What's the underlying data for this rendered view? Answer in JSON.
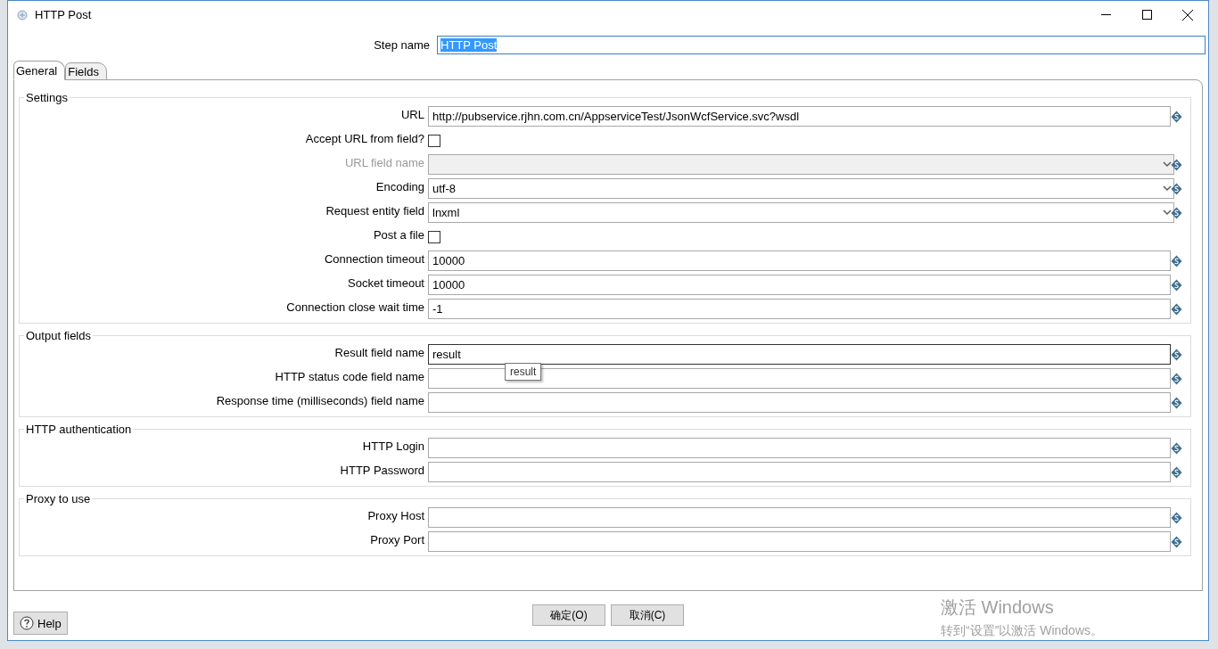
{
  "window": {
    "title": "HTTP Post"
  },
  "step_name": {
    "label": "Step name",
    "value": "HTTP Post",
    "text_selected": true
  },
  "tabs": [
    {
      "label": "General",
      "selected": true
    },
    {
      "label": "Fields",
      "selected": false
    }
  ],
  "groups": [
    {
      "title": "Settings",
      "rows": [
        {
          "kind": "text",
          "label": "URL",
          "value": "http://pubservice.rjhn.com.cn/AppserviceTest/JsonWcfService.svc?wsdl",
          "disabled": false,
          "focused": false
        },
        {
          "kind": "checkbox",
          "label": "Accept URL from field?",
          "checked": false
        },
        {
          "kind": "select",
          "label": "URL field name",
          "disabled": true
        },
        {
          "kind": "select",
          "label": "Encoding",
          "value": "utf-8",
          "disabled": false
        },
        {
          "kind": "select",
          "label": "Request entity field",
          "value": "lnxml",
          "disabled": false
        },
        {
          "kind": "checkbox",
          "label": "Post a file",
          "checked": false
        },
        {
          "kind": "text",
          "label": "Connection timeout",
          "value": "10000",
          "disabled": false,
          "focused": false
        },
        {
          "kind": "text",
          "label": "Socket timeout",
          "value": "10000",
          "disabled": false,
          "focused": false
        },
        {
          "kind": "text",
          "label": "Connection close wait time",
          "value": "-1",
          "disabled": false,
          "focused": false
        }
      ]
    },
    {
      "title": "Output fields",
      "rows": [
        {
          "kind": "text",
          "label": "Result field name",
          "value": "result",
          "disabled": false,
          "focused": true,
          "tooltip": "result"
        },
        {
          "kind": "text",
          "label": "HTTP status code field name",
          "disabled": false,
          "focused": false
        },
        {
          "kind": "text",
          "label": "Response time (milliseconds) field name",
          "disabled": false,
          "focused": false
        }
      ]
    },
    {
      "title": "HTTP authentication",
      "rows": [
        {
          "kind": "text",
          "label": "HTTP Login",
          "disabled": false,
          "focused": false
        },
        {
          "kind": "text",
          "label": "HTTP Password",
          "disabled": false,
          "focused": false
        }
      ]
    },
    {
      "title": "Proxy to use",
      "rows": [
        {
          "kind": "text",
          "label": "Proxy Host",
          "disabled": false,
          "focused": false
        },
        {
          "kind": "text",
          "label": "Proxy Port",
          "disabled": false,
          "focused": false
        }
      ]
    }
  ],
  "help_button": "Help",
  "buttons": [
    "确定(O)",
    "取消(C)"
  ],
  "os_notice": {
    "title": "激活 Windows",
    "text": "转到“设置”以激活 Windows。"
  }
}
